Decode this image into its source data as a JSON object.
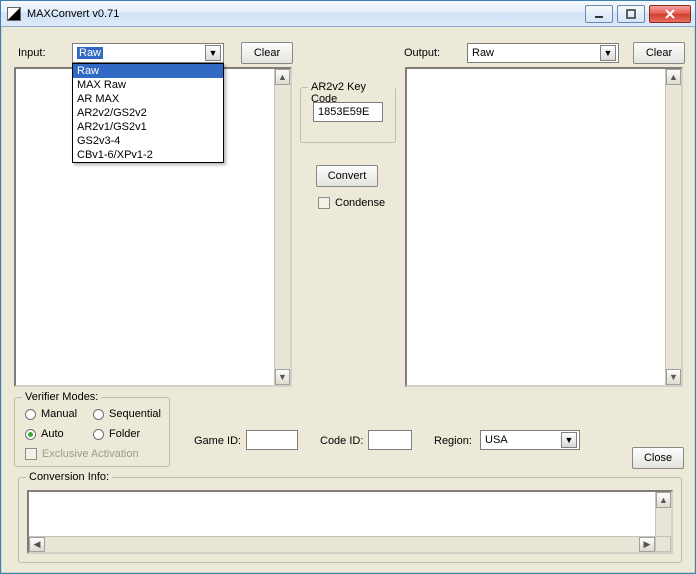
{
  "window": {
    "title": "MAXConvert v0.71"
  },
  "input": {
    "label": "Input:",
    "selected": "Raw",
    "options": [
      "Raw",
      "MAX Raw",
      "AR MAX",
      "AR2v2/GS2v2",
      "AR2v1/GS2v1",
      "GS2v3-4",
      "CBv1-6/XPv1-2"
    ],
    "clear": "Clear"
  },
  "output": {
    "label": "Output:",
    "selected": "Raw",
    "clear": "Clear"
  },
  "keycode": {
    "legend": "AR2v2 Key Code",
    "value": "1853E59E"
  },
  "convert": {
    "label": "Convert"
  },
  "condense": {
    "label": "Condense"
  },
  "verifier": {
    "legend": "Verifier Modes:",
    "manual": "Manual",
    "sequential": "Sequential",
    "auto": "Auto",
    "folder": "Folder",
    "exclusive": "Exclusive Activation"
  },
  "fields": {
    "gameid": "Game ID:",
    "codeid": "Code ID:",
    "region": "Region:",
    "region_value": "USA"
  },
  "close": "Close",
  "convinfo": {
    "legend": "Conversion Info:"
  }
}
